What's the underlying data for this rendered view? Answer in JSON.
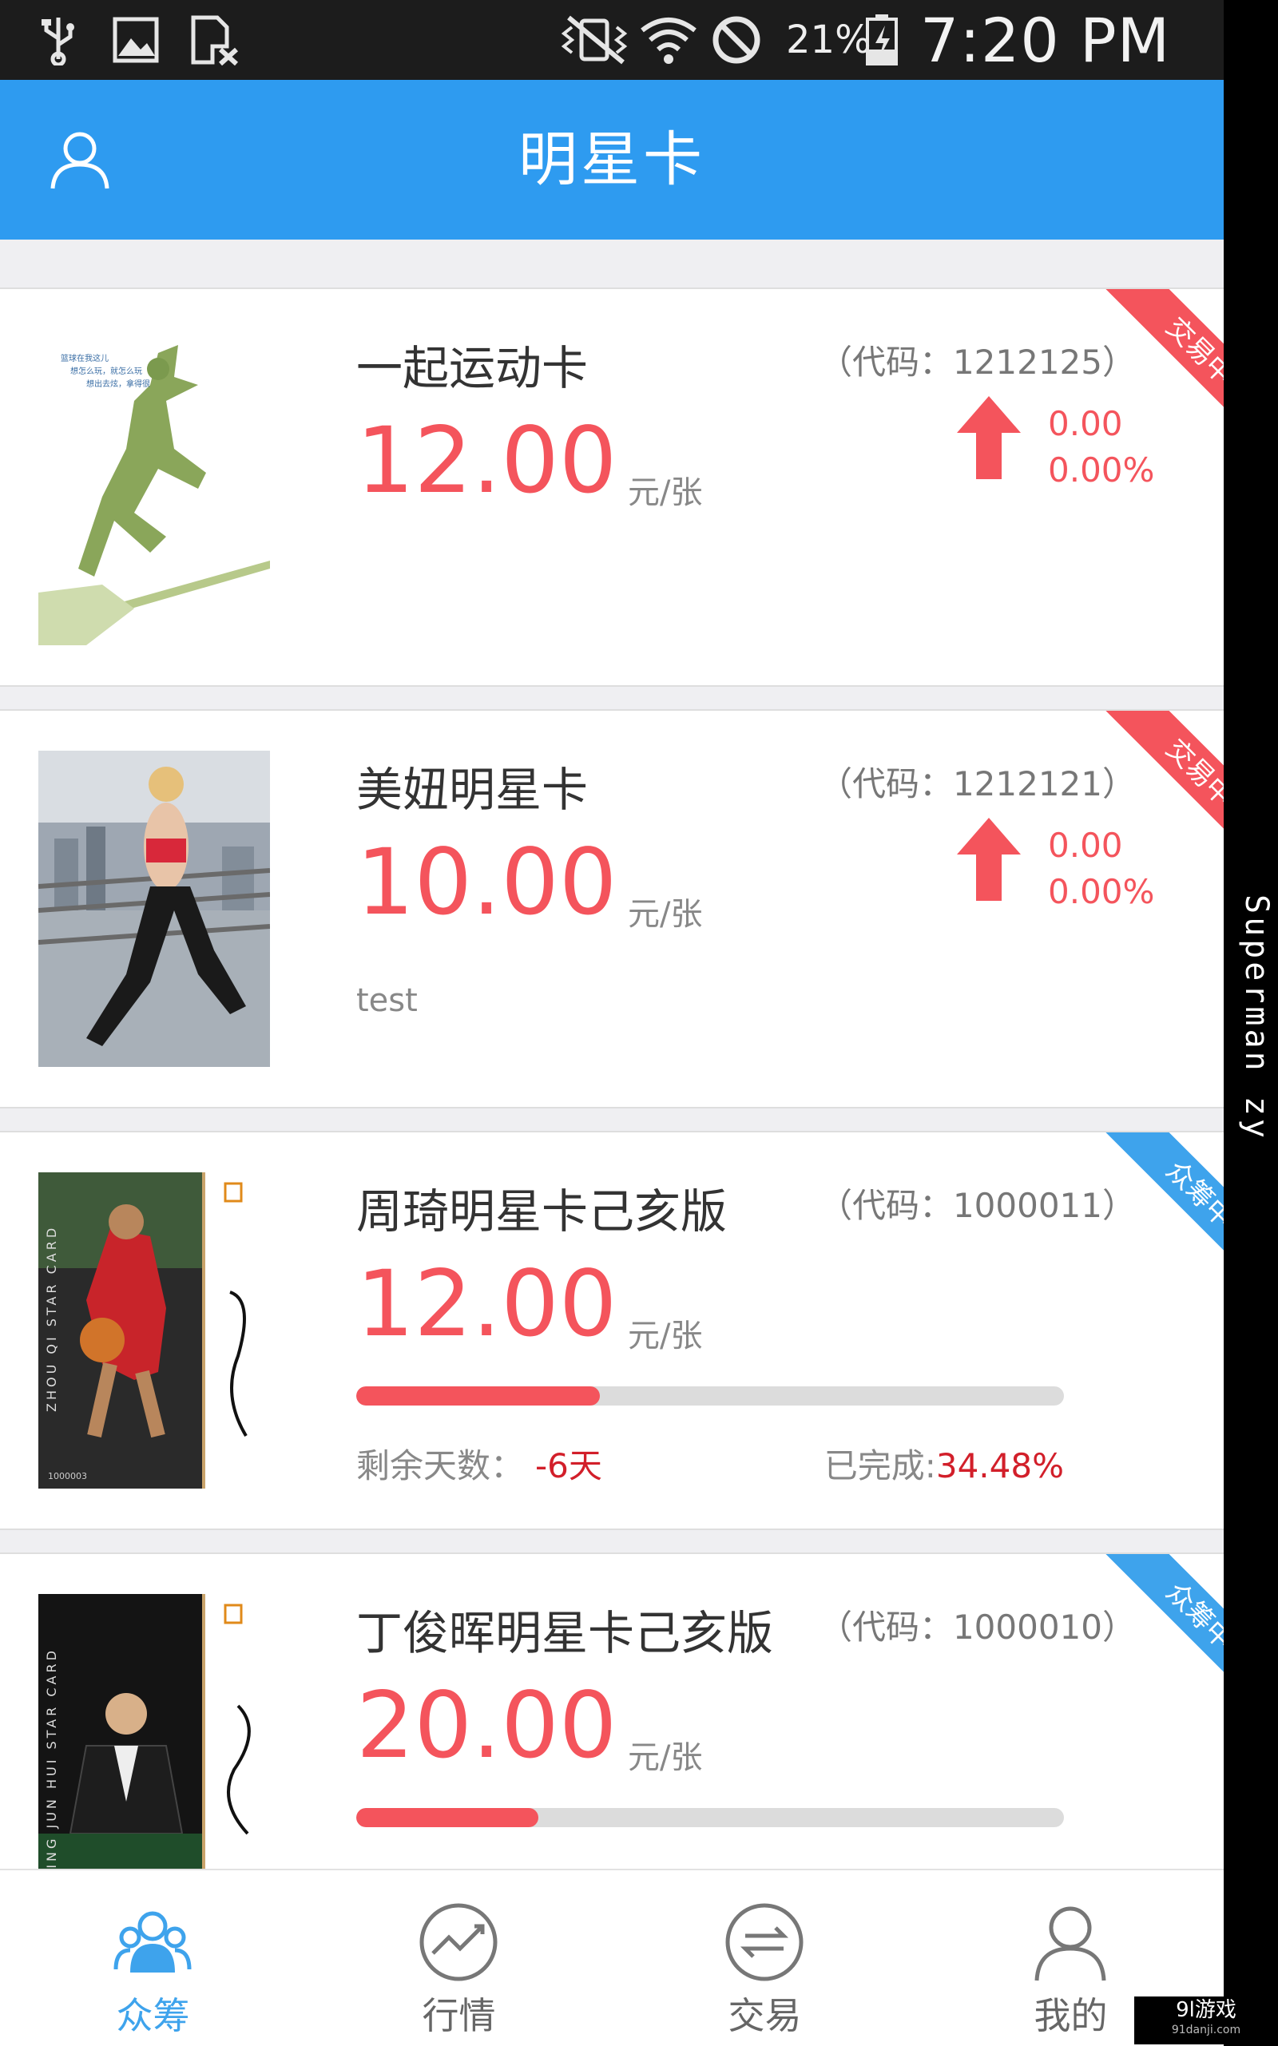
{
  "status_bar": {
    "battery_percent": "21%",
    "time": "7:20 PM",
    "icons": [
      "usb-icon",
      "image-icon",
      "sim-off-icon",
      "vibrate-icon",
      "wifi-icon",
      "block-icon",
      "battery-charging-icon"
    ]
  },
  "header": {
    "title": "明星卡",
    "user_icon": "user-icon"
  },
  "cards": [
    {
      "name": "一起运动卡",
      "code": "（代码：1212125）",
      "price": "12.00",
      "unit": "元/张",
      "change": "0.00",
      "change_pct": "0.00%",
      "badge": "交易中",
      "note": ""
    },
    {
      "name": "美妞明星卡",
      "code": "（代码：1212121）",
      "price": "10.00",
      "unit": "元/张",
      "change": "0.00",
      "change_pct": "0.00%",
      "badge": "交易中",
      "note": "test"
    },
    {
      "name": "周琦明星卡己亥版",
      "code": "（代码：1000011）",
      "price": "12.00",
      "unit": "元/张",
      "badge": "众筹中",
      "progress": 0.3448,
      "days_label": "剩余天数：",
      "days_value": "-6天",
      "done_label": "已完成:",
      "done_value": "34.48%",
      "card_text": "ZHOU QI STAR CARD",
      "card_number": "1000003"
    },
    {
      "name": "丁俊晖明星卡己亥版",
      "code": "（代码：1000010）",
      "price": "20.00",
      "unit": "元/张",
      "badge": "众筹中",
      "progress": 0.257,
      "card_text": "DING JUN HUI STAR CARD"
    }
  ],
  "bottom_nav": [
    {
      "label": "众筹",
      "icon": "crowdfund-icon",
      "active": true
    },
    {
      "label": "行情",
      "icon": "market-chart-icon",
      "active": false
    },
    {
      "label": "交易",
      "icon": "exchange-icon",
      "active": false
    },
    {
      "label": "我的",
      "icon": "profile-icon",
      "active": false
    }
  ],
  "watermark": "Superman zy",
  "corner_logo": "9l游戏",
  "corner_logo_sub": "91danji.com",
  "colors": {
    "primary": "#2e9bf0",
    "price_red": "#f4545c",
    "trading_badge": "#f4545c",
    "crowdfund_badge": "#3ea3ec",
    "nav_active": "#3ea3ec"
  }
}
